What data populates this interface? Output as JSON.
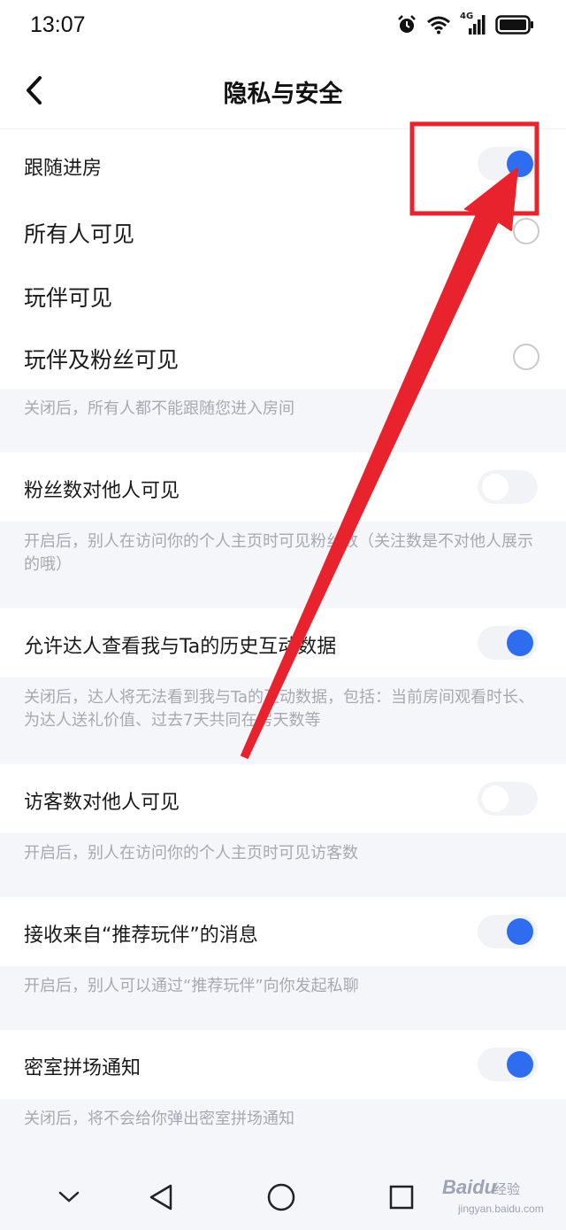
{
  "status_bar": {
    "time": "13:07",
    "network_label": "4G",
    "icons": [
      "alarm-icon",
      "wifi-icon",
      "signal-icon",
      "battery-icon"
    ]
  },
  "header": {
    "title": "隐私与安全",
    "back_icon": "chevron-left-icon"
  },
  "follow_room": {
    "label": "跟随进房",
    "toggle_on": true,
    "options": [
      {
        "label": "所有人可见",
        "selected": false
      },
      {
        "label": "玩伴可见",
        "selected": false
      },
      {
        "label": "玩伴及粉丝可见",
        "selected": false
      }
    ],
    "hint": "关闭后，所有人都不能跟随您进入房间"
  },
  "settings": [
    {
      "label": "粉丝数对他人可见",
      "on": false,
      "hint": "开启后，别人在访问你的个人主页时可见粉丝数（关注数是不对他人展示的哦）"
    },
    {
      "label": "允许达人查看我与Ta的历史互动数据",
      "on": true,
      "hint": "关闭后，达人将无法看到我与Ta的互动数据，包括：当前房间观看时长、为达人送礼价值、过去7天共同在房天数等"
    },
    {
      "label": "访客数对他人可见",
      "on": false,
      "hint": "开启后，别人在访问你的个人主页时可见访客数"
    },
    {
      "label": "接收来自“推荐玩伴”的消息",
      "on": true,
      "hint": "开启后，别人可以通过“推荐玩伴”向你发起私聊"
    },
    {
      "label": "密室拼场通知",
      "on": true,
      "hint": "关闭后，将不会给你弹出密室拼场通知"
    }
  ],
  "bottom_nav": {
    "buttons": [
      "chevron-down-icon",
      "back-triangle-icon",
      "home-circle-icon",
      "recents-square-icon"
    ]
  },
  "watermark": {
    "brand": "Baidu",
    "sub": "经验",
    "url": "jingyan.baidu.com"
  },
  "colors": {
    "accent": "#2f6df0",
    "annotation": "#e8232d",
    "section_bg": "#f5f6fa",
    "hint_text": "#a7a9b2"
  }
}
